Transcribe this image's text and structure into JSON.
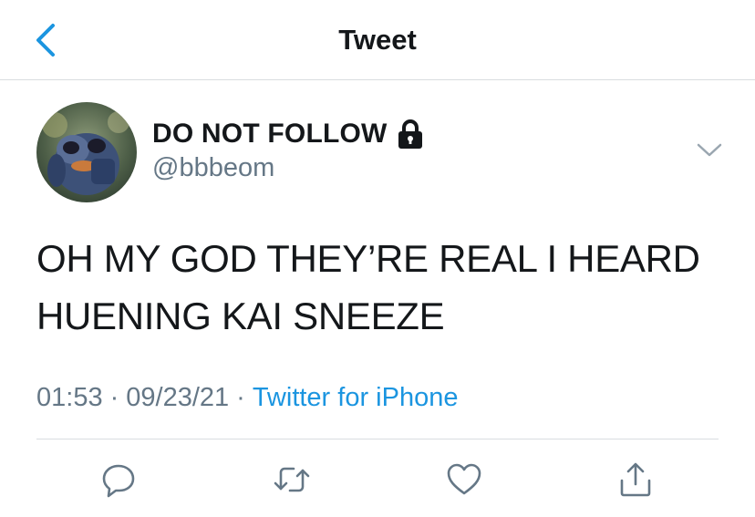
{
  "header": {
    "title": "Tweet",
    "back_icon": "chevron-left-icon"
  },
  "author": {
    "display_name": "DO NOT FOLLOW",
    "handle": "@bbbeom",
    "protected_icon": "lock-icon",
    "avatar_icon": "avatar-image"
  },
  "tweet": {
    "line1": "OH MY GOD THEY’RE REAL I HEARD",
    "line2": "HUENING KAI SNEEZE"
  },
  "meta": {
    "time": "01:53",
    "separator": "·",
    "date": "09/23/21",
    "source": "Twitter for iPhone"
  },
  "actions": {
    "reply_icon": "reply-icon",
    "retweet_icon": "retweet-icon",
    "like_icon": "heart-icon",
    "share_icon": "share-icon"
  },
  "colors": {
    "accent": "#1b95e0",
    "text_primary": "#14171a",
    "text_secondary": "#657786",
    "divider": "#d9dde0"
  }
}
